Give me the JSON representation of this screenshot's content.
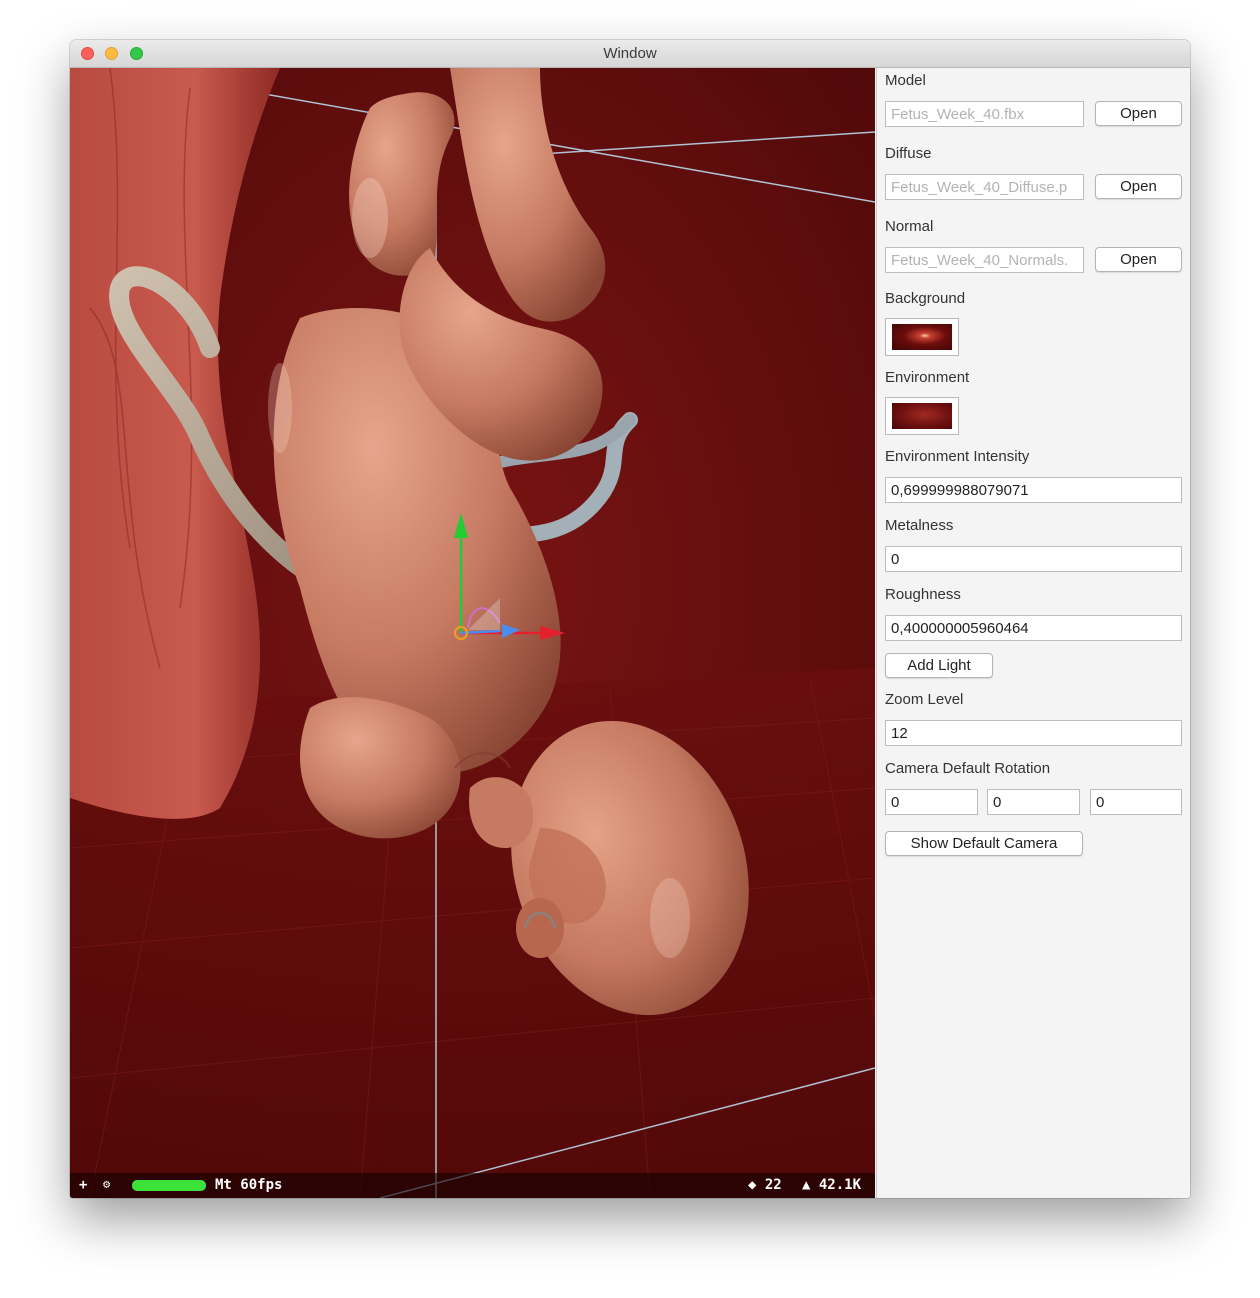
{
  "window": {
    "title": "Window"
  },
  "viewport": {
    "stats": {
      "plus": "+",
      "gear": "⚙",
      "fps": "Mt 60fps",
      "draw_calls": "◆ 22",
      "triangles": "▲ 42.1K"
    }
  },
  "panel": {
    "model": {
      "label": "Model",
      "value": "Fetus_Week_40.fbx",
      "button": "Open"
    },
    "diffuse": {
      "label": "Diffuse",
      "value": "Fetus_Week_40_Diffuse.p",
      "button": "Open"
    },
    "normal": {
      "label": "Normal",
      "value": "Fetus_Week_40_Normals.",
      "button": "Open"
    },
    "background": {
      "label": "Background"
    },
    "environment": {
      "label": "Environment"
    },
    "environment_intensity": {
      "label": "Environment Intensity",
      "value": "0,699999988079071"
    },
    "metalness": {
      "label": "Metalness",
      "value": "0"
    },
    "roughness": {
      "label": "Roughness",
      "value": "0,400000005960464"
    },
    "add_light": "Add Light",
    "zoom_level": {
      "label": "Zoom Level",
      "value": "12"
    },
    "camera_rotation": {
      "label": "Camera Default Rotation",
      "x": "0",
      "y": "0",
      "z": "0"
    },
    "show_default_camera": "Show Default Camera"
  },
  "colors": {
    "background": "#5e0c0c",
    "fps_bar": "#3ae23a",
    "skin": "#c97a62"
  }
}
